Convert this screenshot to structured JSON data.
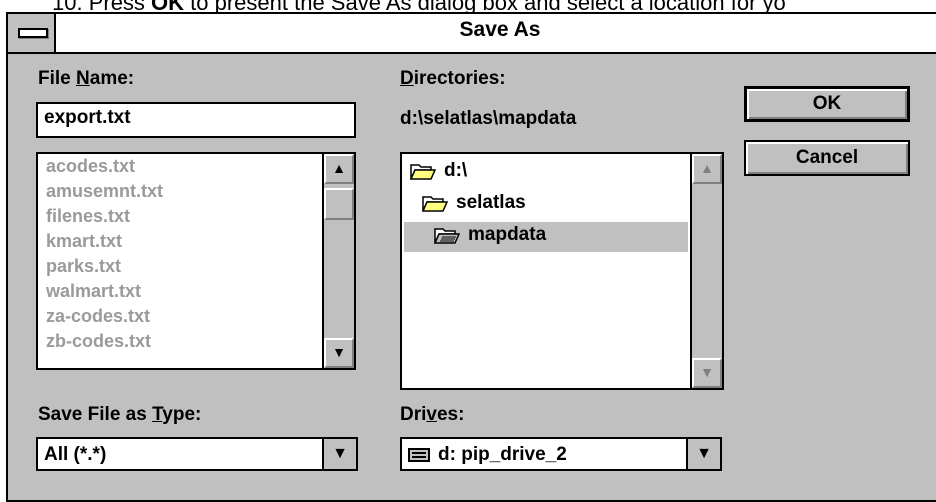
{
  "caption": {
    "prefix": "10. Press ",
    "bold": "OK",
    "suffix": " to present the Save As dialog box and select a location for yo"
  },
  "dialog": {
    "title": "Save As",
    "file_name": {
      "label_pre": "File ",
      "label_u": "N",
      "label_post": "ame:",
      "value": "export.txt",
      "files": [
        "acodes.txt",
        "amusemnt.txt",
        "filenes.txt",
        "kmart.txt",
        "parks.txt",
        "walmart.txt",
        "za-codes.txt",
        "zb-codes.txt"
      ]
    },
    "directories": {
      "label_u": "D",
      "label_post": "irectories:",
      "current_path": "d:\\selatlas\\mapdata",
      "items": [
        "d:\\",
        "selatlas",
        "mapdata"
      ]
    },
    "save_type": {
      "label_pre": "Save File as ",
      "label_u": "T",
      "label_post": "ype:",
      "value": "All (*.*)"
    },
    "drives": {
      "label_pre": "Dri",
      "label_u": "v",
      "label_post": "es:",
      "value": "d: pip_drive_2"
    },
    "buttons": {
      "ok": "OK",
      "cancel": "Cancel"
    },
    "icons": {
      "up": "arrow-up-icon",
      "down": "arrow-down-icon",
      "folder_open": "folder-open-icon",
      "drive": "drive-icon"
    }
  }
}
